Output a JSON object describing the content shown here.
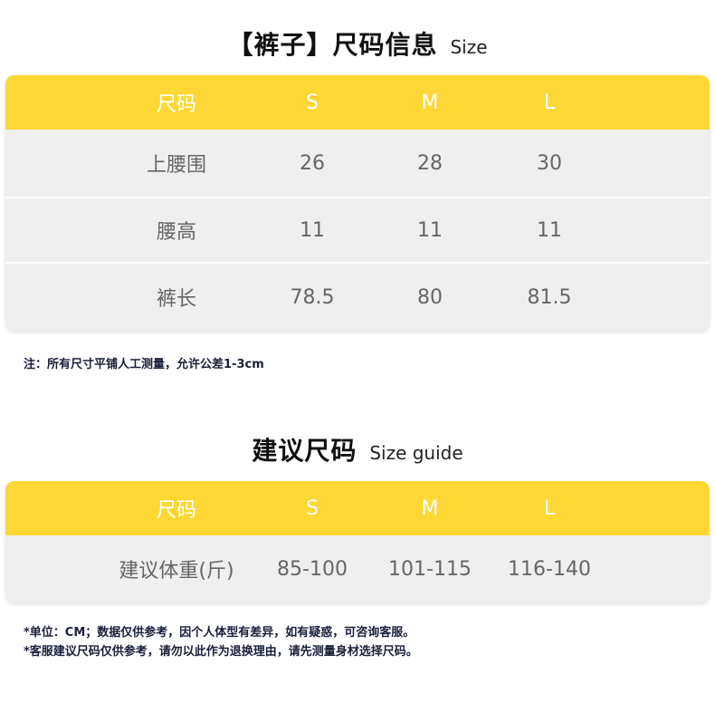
{
  "section1": {
    "title_cn": "【裤子】尺码信息",
    "title_en": "Size",
    "header": [
      "尺码",
      "S",
      "M",
      "L"
    ],
    "rows": [
      [
        "上腰围",
        "26",
        "28",
        "30"
      ],
      [
        "腰高",
        "11",
        "11",
        "11"
      ],
      [
        "裤长",
        "78.5",
        "80",
        "81.5"
      ]
    ],
    "note": "注：所有尺寸平铺人工测量，允许公差1-3cm"
  },
  "section2": {
    "title_cn": "建议尺码",
    "title_en": "Size guide",
    "header": [
      "尺码",
      "S",
      "M",
      "L"
    ],
    "rows": [
      [
        "建议体重(斤)",
        "85-100",
        "101-115",
        "116-140"
      ]
    ],
    "notes": [
      "*单位：CM；数据仅供参考，因个人体型有差异，如有疑惑，可咨询客服。",
      "*客服建议尺码仅供参考，请勿以此作为退换理由，请先测量身材选择尺码。"
    ]
  },
  "colors": {
    "header_bg": "#fdd835",
    "row_bg": "#efefef",
    "text": "#666666",
    "note_text": "#1a1f3a"
  }
}
